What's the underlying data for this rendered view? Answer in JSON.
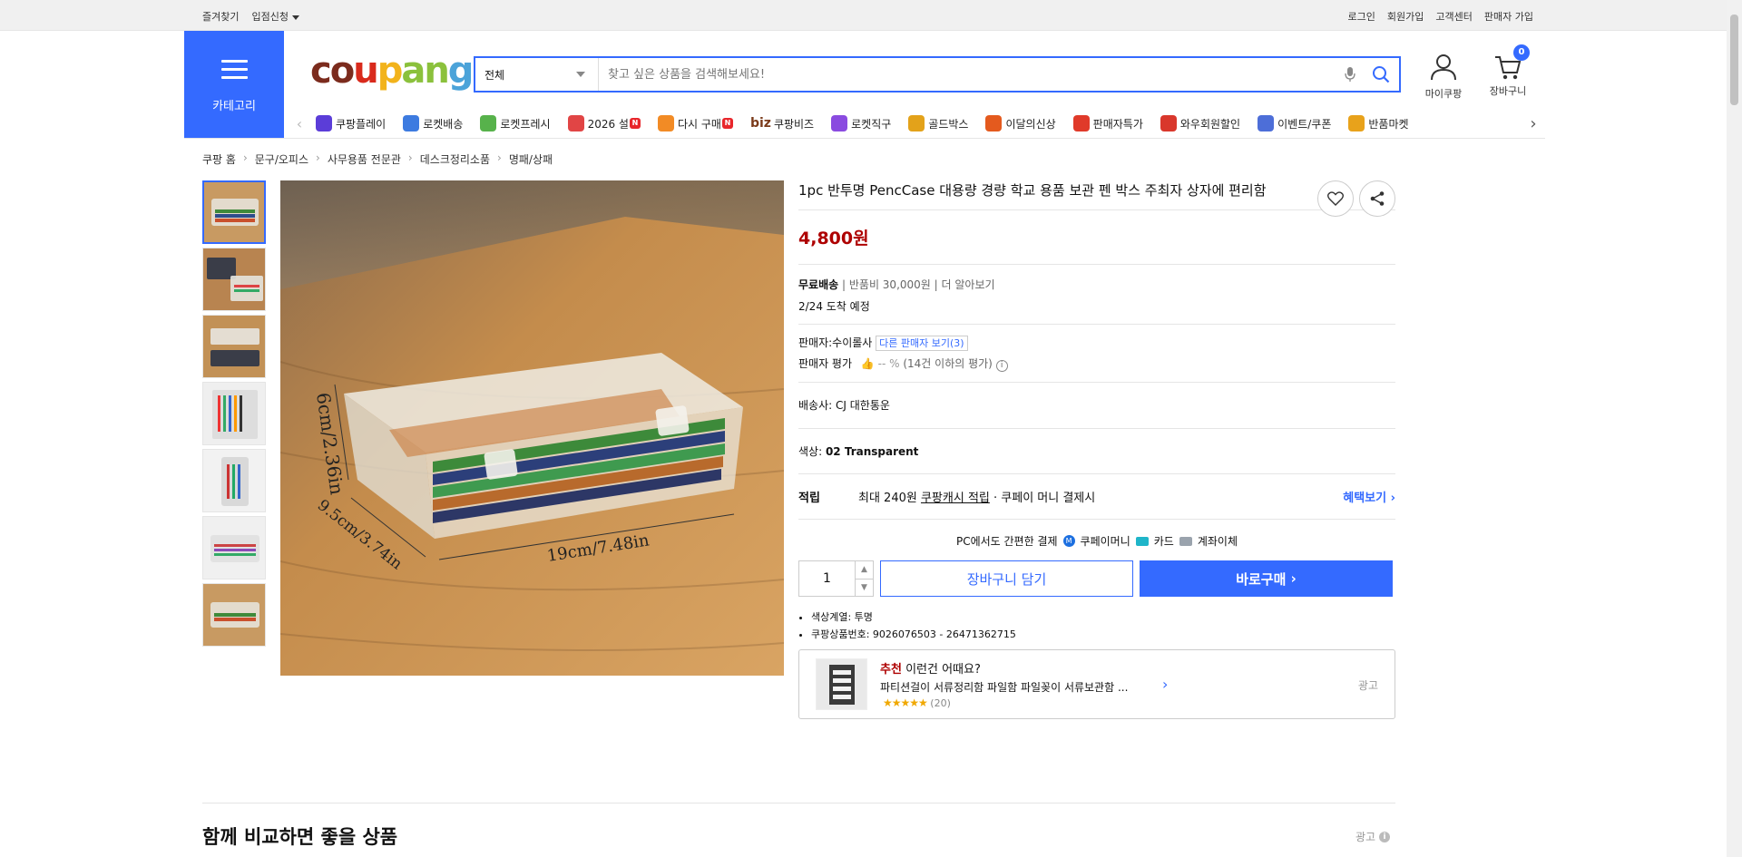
{
  "topbar": {
    "left": [
      "즐겨찾기",
      "입점신청"
    ],
    "right": [
      "로그인",
      "회원가입",
      "고객센터",
      "판매자 가입"
    ]
  },
  "category": {
    "label": "카테고리"
  },
  "logo": {
    "parts": [
      "co",
      "u",
      "p",
      "an",
      "g"
    ]
  },
  "search": {
    "scope": "전체",
    "placeholder": "찾고 싶은 상품을 검색해보세요!"
  },
  "header": {
    "mycoupang": "마이쿠팡",
    "cart": "장바구니",
    "cart_count": "0"
  },
  "nav": {
    "items": [
      {
        "label": "쿠팡플레이",
        "color": "#5b3dd8",
        "badge": ""
      },
      {
        "label": "로켓배송",
        "color": "#3d7be0",
        "badge": ""
      },
      {
        "label": "로켓프레시",
        "color": "#57b24b",
        "badge": ""
      },
      {
        "label": "2026 설",
        "color": "#e14545",
        "badge": "N"
      },
      {
        "label": "다시 구매",
        "color": "#f28b25",
        "badge": "N"
      },
      {
        "label": "쿠팡비즈",
        "color": "#7b3b1b",
        "badge": "",
        "prefix": "biz"
      },
      {
        "label": "로켓직구",
        "color": "#8a4be0",
        "badge": ""
      },
      {
        "label": "골드박스",
        "color": "#e3a21a",
        "badge": ""
      },
      {
        "label": "이달의신상",
        "color": "#e45a1e",
        "badge": ""
      },
      {
        "label": "판매자특가",
        "color": "#e03a2a",
        "badge": ""
      },
      {
        "label": "와우회원할인",
        "color": "#d9372c",
        "badge": ""
      },
      {
        "label": "이벤트/쿠폰",
        "color": "#4d6ed8",
        "badge": ""
      },
      {
        "label": "반품마켓",
        "color": "#e8a21b",
        "badge": ""
      }
    ]
  },
  "breadcrumb": [
    "쿠팡 홈",
    "문구/오피스",
    "사무용품 전문관",
    "데스크정리소품",
    "명패/상패"
  ],
  "image_labels": {
    "height": "6cm/2.36in",
    "depth": "9.5cm/3.74in",
    "width": "19cm/7.48in"
  },
  "product": {
    "title": "1pc 반투명 PencCase 대용량 경량 학교 용품 보관 펜 박스 주최자 상자에 편리함",
    "price": "4,800원",
    "shipping_label": "무료배송",
    "return_fee": "반품비 30,000원",
    "more": "더 알아보기",
    "arrival": "2/24 도착 예정",
    "seller_label": "판매자:",
    "seller_name": "수이롤사",
    "other_sellers": "다른 판매자 보기(3)",
    "seller_rating_label": "판매자 평가",
    "seller_rating": "-- %",
    "seller_rating_note": "(14건 이하의 평가)",
    "carrier_label": "배송사:",
    "carrier": "CJ 대한통운",
    "color_label": "색상:",
    "color": "02 Transparent",
    "reward_label": "적립",
    "reward_prefix": "최대 240원",
    "reward_link": "쿠팡캐시 적립",
    "reward_suffix": "· 쿠페이 머니 결제시",
    "benefit_link": "혜택보기",
    "pay_label": "PC에서도 간편한 결제",
    "pay_methods": [
      "쿠페이머니",
      "카드",
      "계좌이체"
    ],
    "quantity": "1",
    "cart_button": "장바구니 담기",
    "buy_button": "바로구매",
    "specs": [
      "색상계열: 투명",
      "쿠팡상품번호: 9026076503 - 26471362715"
    ]
  },
  "recommend": {
    "prefix": "추천",
    "headline": "이런건 어때요?",
    "name": "파티션걸이 서류정리함 파일함 파일꽂이 서류보관함 ...",
    "stars": "★★★★★",
    "reviews": "(20)",
    "ad": "광고"
  },
  "bottom": {
    "title": "함께 비교하면 좋을 상품",
    "ad": "광고"
  }
}
